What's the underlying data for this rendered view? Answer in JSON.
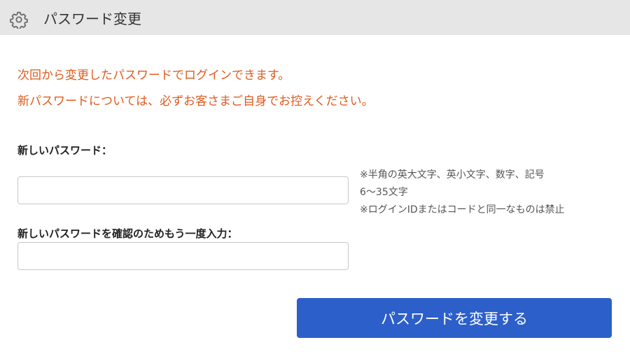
{
  "header": {
    "title": "パスワード変更",
    "icon": "gear-icon"
  },
  "notice": {
    "line1": "次回から変更したパスワードでログインできます。",
    "line2": "新パスワードについては、必ずお客さまご自身でお控えください。",
    "color": "#e05a1e"
  },
  "form": {
    "new_password_label": "新しいパスワード：",
    "new_password_value": "",
    "confirm_password_label": "新しいパスワードを確認のためもう一度入力：",
    "confirm_password_value": "",
    "hints": [
      "※半角の英大文字、英小文字、数字、記号",
      "6〜35文字",
      "※ログインIDまたはコードと同一なものは禁止"
    ],
    "submit_label": "パスワードを変更する",
    "submit_color": "#2c5fc9"
  }
}
